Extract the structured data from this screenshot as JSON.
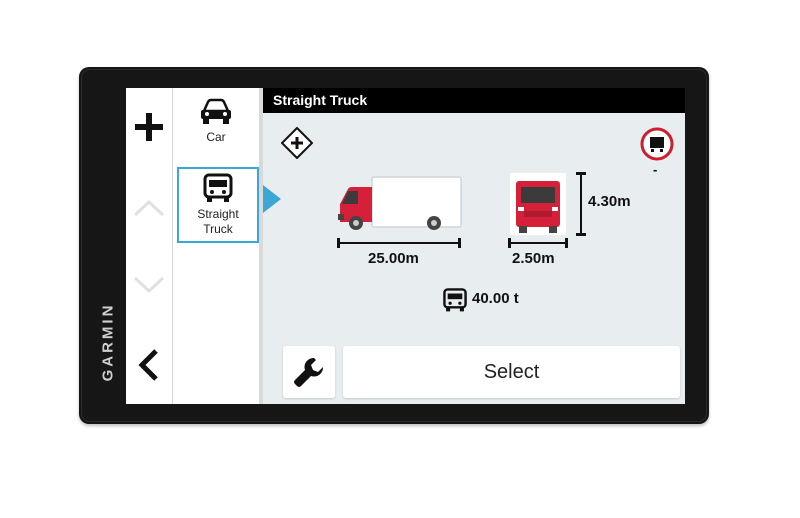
{
  "device": {
    "brand": "GARMIN"
  },
  "header": {
    "title": "Straight Truck"
  },
  "vehicles": [
    {
      "label": "Car",
      "icon": "car-icon"
    },
    {
      "label": "Straight\nTruck",
      "icon": "truck-icon",
      "selected": true
    }
  ],
  "specs": {
    "length": "25.00m",
    "width": "2.50m",
    "height": "4.30m",
    "weight": "40.00 t",
    "restriction_value": "-"
  },
  "actions": {
    "select_label": "Select",
    "settings_icon": "wrench-icon"
  },
  "colors": {
    "accent": "#3aa7d6",
    "truck_red": "#d6203a",
    "restriction_red": "#cc1f2d"
  }
}
